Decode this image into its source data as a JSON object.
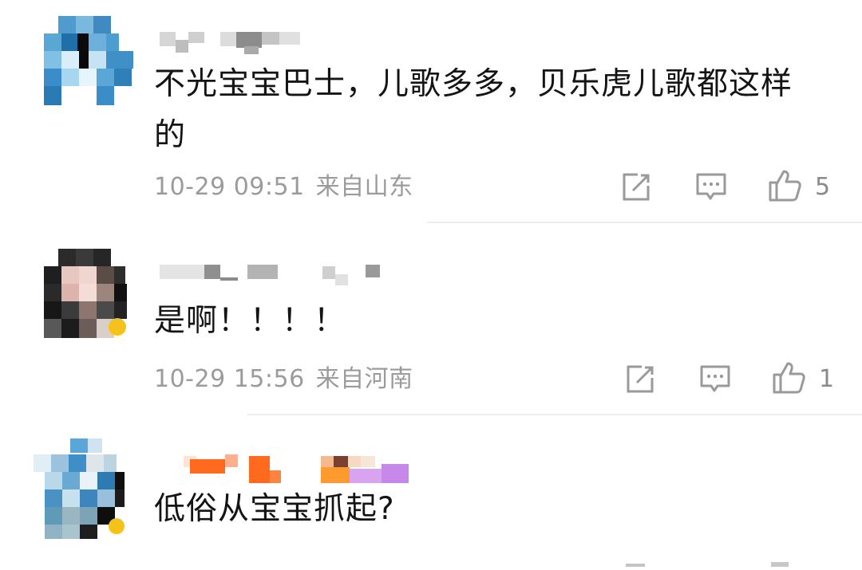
{
  "comments": [
    {
      "text": "不光宝宝巴士，儿歌多多，贝乐虎儿歌都这样\n的",
      "date": "10-29 09:51",
      "location": "来自山东",
      "likes": "5"
    },
    {
      "text": "是啊！！！！",
      "date": "10-29 15:56",
      "location": "来自河南",
      "likes": "1"
    },
    {
      "text": "低俗从宝宝抓起?"
    }
  ],
  "icons": {
    "repost": "share-edit-icon",
    "reply": "comment-bubble-icon",
    "like": "thumbs-up-icon"
  },
  "colors": {
    "text": "#141414",
    "meta": "#9b9b9b",
    "icon": "#9a9a9a",
    "divider": "#ececec"
  }
}
